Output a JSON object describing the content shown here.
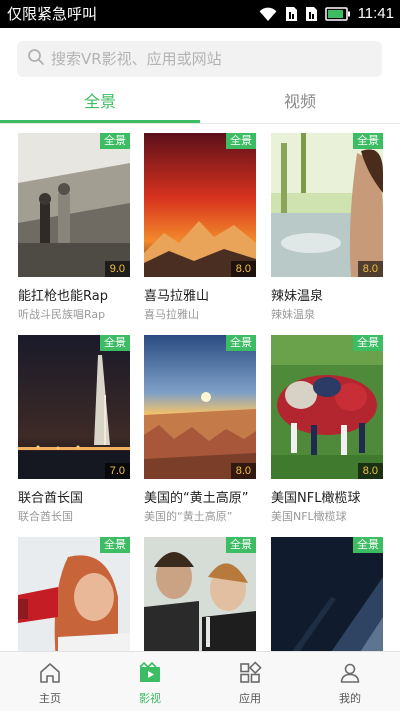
{
  "status_bar": {
    "carrier_text": "仅限紧急呼叫",
    "time": "11:41",
    "icons": [
      "wifi-icon",
      "sim-card-icon",
      "sim-card-icon",
      "battery-icon"
    ]
  },
  "search": {
    "placeholder": "搜索VR影视、应用或网站",
    "icon": "search-icon"
  },
  "tabs": [
    {
      "label": "全景",
      "active": true
    },
    {
      "label": "视频",
      "active": false
    }
  ],
  "items": [
    {
      "title": "能扛枪也能Rap",
      "subtitle": "听战斗民族唱Rap",
      "badge": "全景",
      "score": "9.0",
      "image": "vintage-photo-group-on-porch"
    },
    {
      "title": "喜马拉雅山",
      "subtitle": "喜马拉雅山",
      "badge": "全景",
      "score": "8.0",
      "image": "red-sunset-mountains"
    },
    {
      "title": "辣妹温泉",
      "subtitle": "辣妹温泉",
      "badge": "全景",
      "score": "8.0",
      "image": "hot-spring-woman"
    },
    {
      "title": "联合酋长国",
      "subtitle": "联合酋长国",
      "badge": "全景",
      "score": "7.0",
      "image": "burj-al-arab-night"
    },
    {
      "title": "美国的“黄土高原”",
      "subtitle": "美国的“黄土高原”",
      "badge": "全景",
      "score": "8.0",
      "image": "bryce-canyon-sunrise"
    },
    {
      "title": "美国NFL橄榄球",
      "subtitle": "美国NFL橄榄球",
      "badge": "全景",
      "score": "8.0",
      "image": "rugby-scrum"
    },
    {
      "title": "",
      "subtitle": "",
      "badge": "全景",
      "score": "",
      "image": "woman-with-megaphone"
    },
    {
      "title": "",
      "subtitle": "",
      "badge": "全景",
      "score": "",
      "image": "couple-with-wine"
    },
    {
      "title": "",
      "subtitle": "",
      "badge": "全景",
      "score": "",
      "image": "dark-architecture"
    }
  ],
  "bottom_nav": [
    {
      "label": "主页",
      "icon": "home-icon",
      "active": false
    },
    {
      "label": "影视",
      "icon": "film-icon",
      "active": true
    },
    {
      "label": "应用",
      "icon": "apps-icon",
      "active": false
    },
    {
      "label": "我的",
      "icon": "profile-icon",
      "active": false
    }
  ],
  "colors": {
    "accent": "#3dbd63",
    "score_text": "#f5c242",
    "status_bar": "#000000"
  }
}
